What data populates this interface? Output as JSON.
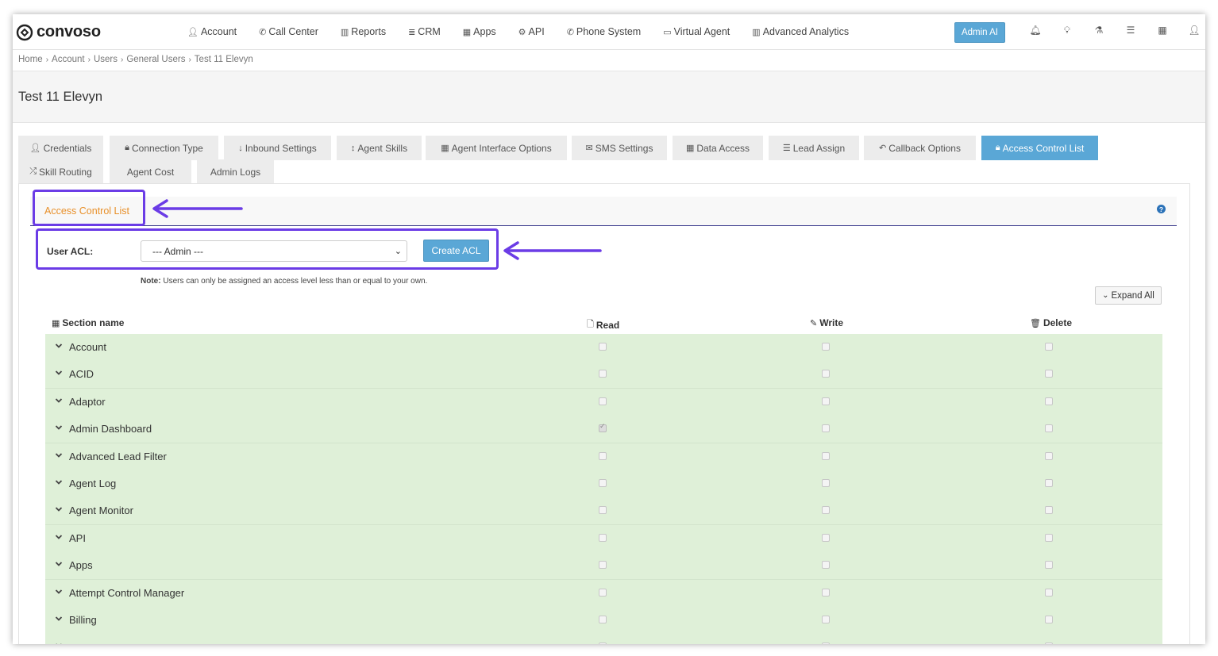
{
  "brand": {
    "name": "convoso"
  },
  "nav": {
    "items": [
      {
        "icon": "user-icon",
        "label": "Account"
      },
      {
        "icon": "phone-icon",
        "label": "Call Center"
      },
      {
        "icon": "bar-chart-icon",
        "label": "Reports"
      },
      {
        "icon": "list-icon",
        "label": "CRM"
      },
      {
        "icon": "grid-icon",
        "label": "Apps"
      },
      {
        "icon": "gear-icon",
        "label": "API"
      },
      {
        "icon": "phone-icon",
        "label": "Phone System"
      },
      {
        "icon": "monitor-icon",
        "label": "Virtual Agent"
      },
      {
        "icon": "bar-chart-icon",
        "label": "Advanced Analytics"
      }
    ],
    "admin_ai_label": "Admin AI"
  },
  "breadcrumb": [
    "Home",
    "Account",
    "Users",
    "General Users",
    "Test 11 Elevyn"
  ],
  "page": {
    "title": "Test 11 Elevyn"
  },
  "tabs": [
    {
      "icon": "user-icon",
      "label": "Credentials",
      "active": false
    },
    {
      "icon": "lock-icon",
      "label": "Connection Type",
      "active": false
    },
    {
      "icon": "arrow-down-icon",
      "label": "Inbound Settings",
      "active": false
    },
    {
      "icon": "arrows-vertical-icon",
      "label": "Agent Skills",
      "active": false
    },
    {
      "icon": "grid-icon",
      "label": "Agent Interface Options",
      "active": false
    },
    {
      "icon": "envelope-icon",
      "label": "SMS Settings",
      "active": false
    },
    {
      "icon": "grid-icon",
      "label": "Data Access",
      "active": false
    },
    {
      "icon": "ordered-list-icon",
      "label": "Lead Assign",
      "active": false
    },
    {
      "icon": "reply-icon",
      "label": "Callback Options",
      "active": false
    },
    {
      "icon": "lock-icon",
      "label": "Access Control List",
      "active": true
    },
    {
      "icon": "shuffle-icon",
      "label": "Skill Routing",
      "active": false
    },
    {
      "icon": "",
      "label": "Agent Cost",
      "active": false
    },
    {
      "icon": "",
      "label": "Admin Logs",
      "active": false
    }
  ],
  "acl": {
    "section_title": "Access Control List",
    "user_acl_label": "User ACL:",
    "selected_acl": "--- Admin ---",
    "create_button": "Create ACL",
    "note_label": "Note:",
    "note_text": " Users can only be assigned an access level less than or equal to your own.",
    "expand_all": "Expand All"
  },
  "table": {
    "columns": {
      "section": "Section name",
      "read": "Read",
      "write": "Write",
      "delete": "Delete"
    },
    "rows": [
      {
        "name": "Account",
        "read": false,
        "write": false,
        "delete": false
      },
      {
        "name": "ACID",
        "read": false,
        "write": false,
        "delete": false
      },
      {
        "name": "Adaptor",
        "read": false,
        "write": false,
        "delete": false
      },
      {
        "name": "Admin Dashboard",
        "read": true,
        "write": false,
        "delete": false
      },
      {
        "name": "Advanced Lead Filter",
        "read": false,
        "write": false,
        "delete": false
      },
      {
        "name": "Agent Log",
        "read": false,
        "write": false,
        "delete": false
      },
      {
        "name": "Agent Monitor",
        "read": false,
        "write": false,
        "delete": false
      },
      {
        "name": "API",
        "read": false,
        "write": false,
        "delete": false
      },
      {
        "name": "Apps",
        "read": false,
        "write": false,
        "delete": false
      },
      {
        "name": "Attempt Control Manager",
        "read": false,
        "write": false,
        "delete": false
      },
      {
        "name": "Billing",
        "read": false,
        "write": false,
        "delete": false
      },
      {
        "name": "",
        "read": false,
        "write": false,
        "delete": false
      }
    ]
  },
  "colors": {
    "accent": "#5aa7d6",
    "highlight": "#6b3ce6",
    "row_bg": "#dff0d8",
    "section_title": "#e8902a"
  }
}
